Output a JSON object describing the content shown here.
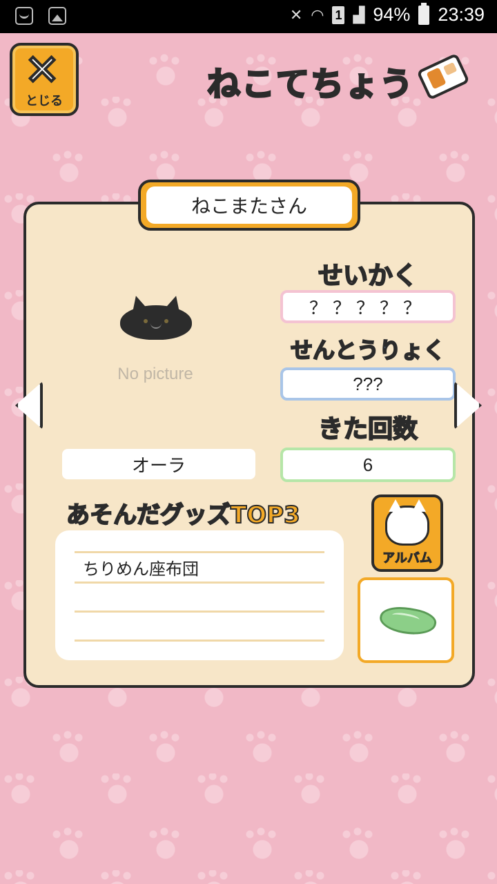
{
  "status_bar": {
    "battery": "94%",
    "time": "23:39",
    "sim": "1"
  },
  "header": {
    "close_label": "とじる",
    "close_symbol": "✕",
    "title": "ねこてちょう"
  },
  "cat": {
    "name": "ねこまたさん",
    "picture_placeholder": "No picture"
  },
  "personality": {
    "label": "せいかく",
    "value": "？？？？？"
  },
  "power": {
    "label": "せんとうりょく",
    "value": "???"
  },
  "visits": {
    "label": "きた回数",
    "value": "6"
  },
  "aura": {
    "value": "オーラ"
  },
  "goods": {
    "label": "あそんだグッズTOP3",
    "items": [
      "ちりめん座布団",
      "",
      ""
    ]
  },
  "album": {
    "label": "アルバム"
  },
  "colors": {
    "background": "#f1b8c6",
    "card": "#f7e6c8",
    "accent": "#f3a927",
    "personality": "#f6b6c8",
    "power": "#7ab0e8",
    "visits": "#9be08f"
  }
}
